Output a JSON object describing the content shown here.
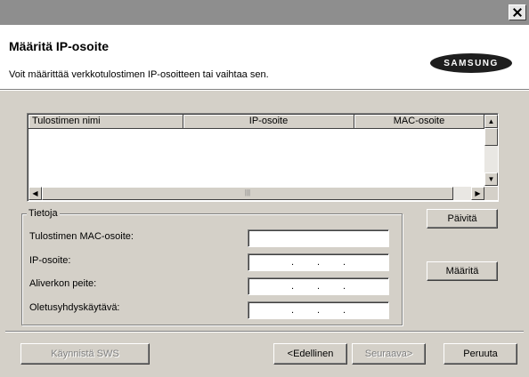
{
  "window": {
    "close_icon": "close-icon"
  },
  "header": {
    "title": "Määritä IP-osoite",
    "subtitle": "Voit määrittää verkkotulostimen IP-osoitteen tai vaihtaa sen.",
    "logo_text": "SAMSUNG"
  },
  "printer_list": {
    "columns": [
      "Tulostimen nimi",
      "IP-osoite",
      "MAC-osoite"
    ],
    "rows": []
  },
  "info": {
    "legend": "Tietoja",
    "mac_label": "Tulostimen MAC-osoite:",
    "ip_label": "IP-osoite:",
    "subnet_label": "Aliverkon peite:",
    "gateway_label": "Oletusyhdyskäytävä:"
  },
  "buttons": {
    "refresh": "Päivitä",
    "configure": "Määritä",
    "start_sws": "Käynnistä SWS",
    "back": "<Edellinen",
    "next": "Seuraava>",
    "cancel": "Peruuta"
  }
}
